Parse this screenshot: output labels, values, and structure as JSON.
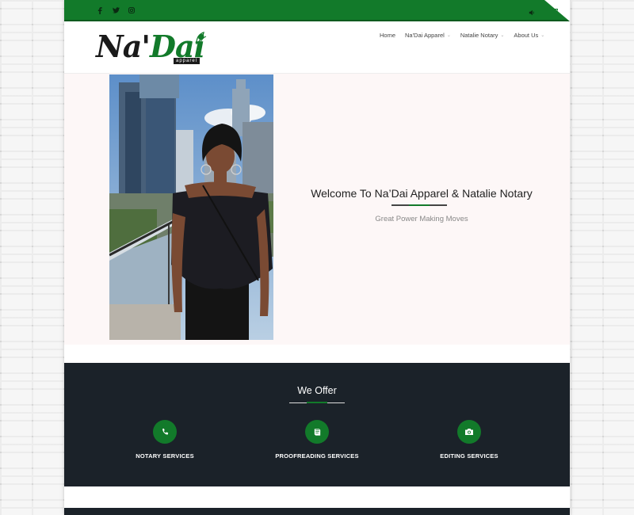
{
  "header": {
    "logo_text_na": "Na'",
    "logo_text_dai": "Dai",
    "logo_sub": "apparel",
    "nav": [
      {
        "label": "Home"
      },
      {
        "label": "Na'Dai Apparel"
      },
      {
        "label": "Natalie Notary"
      },
      {
        "label": "About Us"
      }
    ]
  },
  "topbar": {
    "social_icons": [
      "facebook-icon",
      "twitter-icon",
      "instagram-icon"
    ],
    "right_icons": [
      "volume-icon",
      "cart-icon"
    ]
  },
  "hero": {
    "title": "Welcome To Na’Dai Apparel & Natalie Notary",
    "subtitle": "Great Power Making Moves"
  },
  "offer": {
    "title": "We Offer",
    "services": [
      {
        "label": "NOTARY SERVICES",
        "icon": "phone-icon"
      },
      {
        "label": "PROOFREADING SERVICES",
        "icon": "book-icon"
      },
      {
        "label": "EDITING SERVICES",
        "icon": "camera-icon"
      }
    ]
  },
  "colors": {
    "brand_green": "#127a2a",
    "dark_section": "#1b2229",
    "hero_bg": "#fdf7f7"
  }
}
